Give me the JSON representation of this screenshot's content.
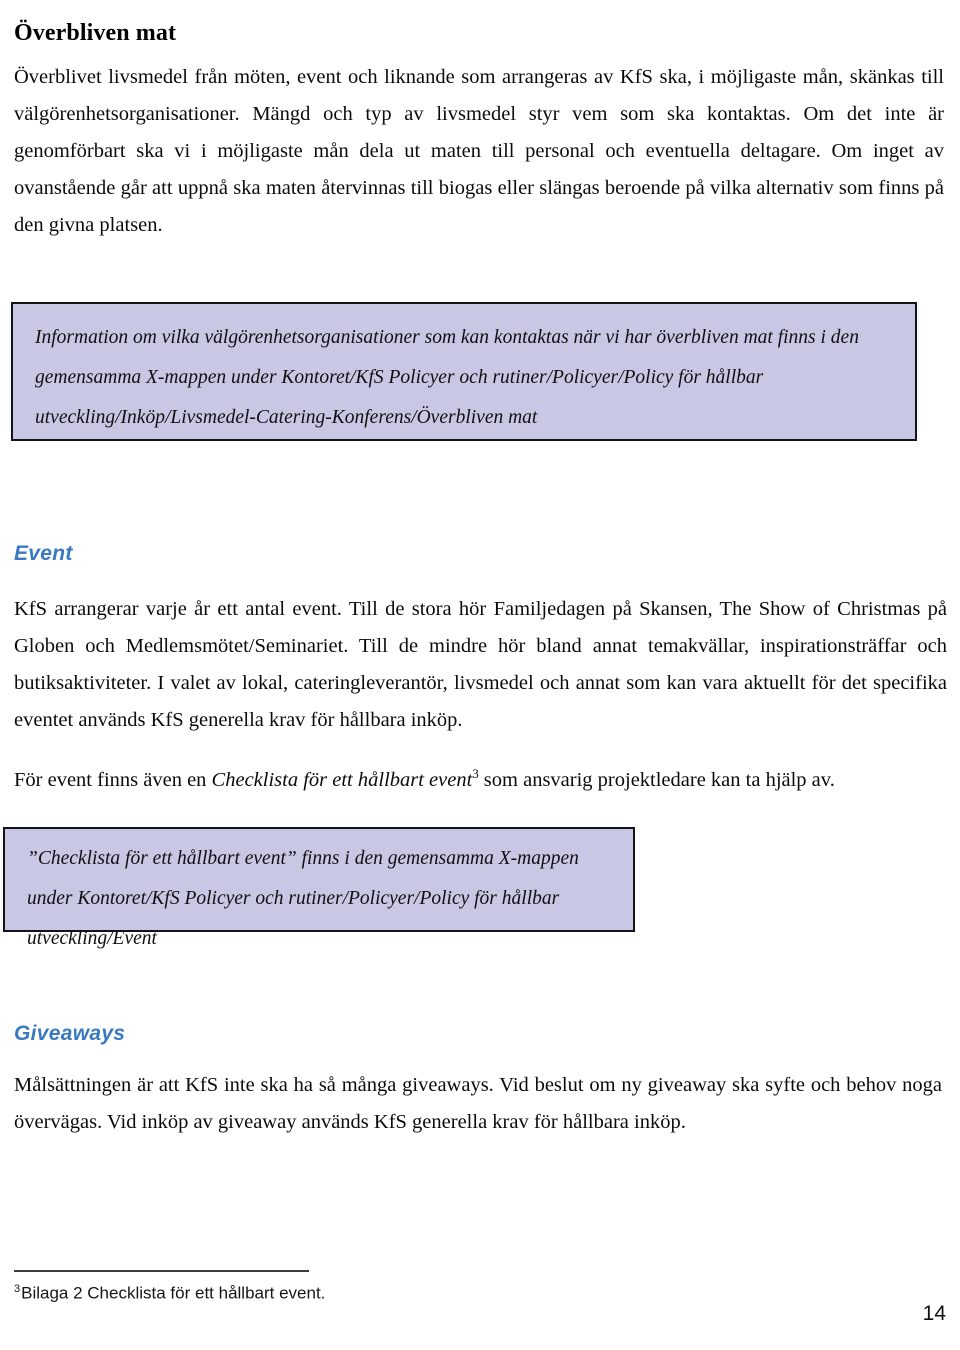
{
  "document": {
    "page_number": "14",
    "title": "Överbliven mat",
    "accent_color": "#3a7ac0",
    "callout_bg_color": "#c8c8e4",
    "callout_border_color": "#141418"
  },
  "sections": {
    "overbliven_mat": {
      "heading": "Överbliven mat",
      "paragraph": "Överblivet livsmedel från möten, event och liknande som arrangeras av KfS ska, i möjligaste mån, skänkas till välgörenhetsorganisationer. Mängd och typ av livsmedel styr vem som ska kontaktas. Om det inte är genomförbart ska vi i möjligaste mån dela ut maten till personal och eventuella deltagare. Om inget av ovanstående går att uppnå ska maten återvinnas till biogas eller slängas beroende på vilka alternativ som finns på den givna platsen.",
      "callout": "Information om vilka välgörenhetsorganisationer som kan kontaktas när vi har överbliven mat finns i den gemensamma X-mappen under Kontoret/KfS Policyer och rutiner/Policyer/Policy för hållbar utveckling/Inköp/Livsmedel-Catering-Konferens/Överbliven mat"
    },
    "event": {
      "heading": "Event",
      "paragraph_1": "KfS arrangerar varje år ett antal event. Till de stora hör Familjedagen på Skansen, The Show of Christmas på Globen och Medlemsmötet/Seminariet. Till de mindre hör bland annat temakvällar, inspirationsträffar och butiksaktiviteter. I valet av lokal, cateringleverantör, livsmedel och annat som kan vara aktuellt för det specifika eventet används KfS generella krav för hållbara inköp.",
      "paragraph_2_before": "För event finns även en ",
      "paragraph_2_italic": "Checklista för ett hållbart event",
      "paragraph_2_superscript": "3",
      "paragraph_2_after": " som ansvarig projektledare kan ta hjälp av.",
      "callout": "”Checklista för ett hållbart event” finns i den gemensamma X-mappen under Kontoret/KfS Policyer och rutiner/Policyer/Policy för hållbar utveckling/Event"
    },
    "giveaways": {
      "heading": "Giveaways",
      "paragraph": "Målsättningen är att KfS inte ska ha så många giveaways. Vid beslut om ny giveaway ska syfte och behov noga övervägas.  Vid inköp av giveaway används KfS generella krav för hållbara inköp."
    }
  },
  "footnote": {
    "marker": "3",
    "text": "Bilaga 2 Checklista för ett hållbart event."
  }
}
